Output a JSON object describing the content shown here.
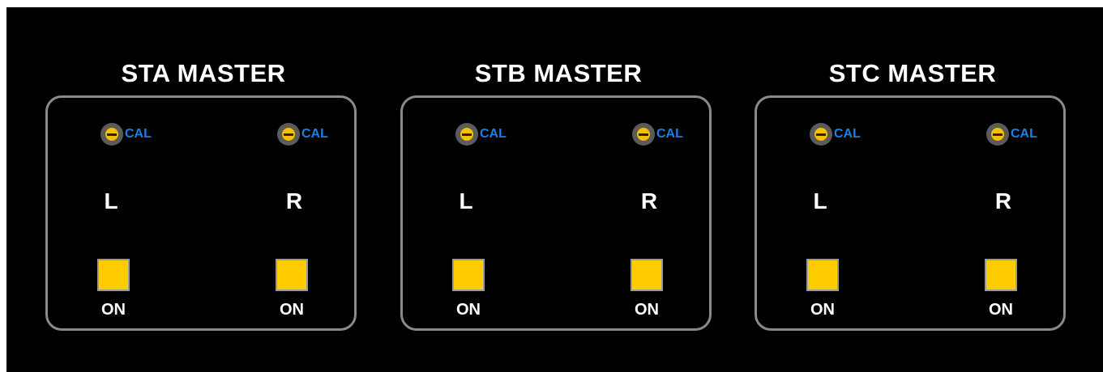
{
  "sections": [
    {
      "title": "STA MASTER",
      "channels": [
        {
          "cal_label": "CAL",
          "letter": "L",
          "on_label": "ON"
        },
        {
          "cal_label": "CAL",
          "letter": "R",
          "on_label": "ON"
        }
      ]
    },
    {
      "title": "STB MASTER",
      "channels": [
        {
          "cal_label": "CAL",
          "letter": "L",
          "on_label": "ON"
        },
        {
          "cal_label": "CAL",
          "letter": "R",
          "on_label": "ON"
        }
      ]
    },
    {
      "title": "STC MASTER",
      "channels": [
        {
          "cal_label": "CAL",
          "letter": "L",
          "on_label": "ON"
        },
        {
          "cal_label": "CAL",
          "letter": "R",
          "on_label": "ON"
        }
      ]
    }
  ],
  "colors": {
    "background": "#000000",
    "box_border": "#8a8a8a",
    "cal_text": "#1a7fe6",
    "knob_body": "#5b5b5b",
    "knob_center": "#f4c000",
    "on_button": "#ffcc00"
  },
  "icons": {
    "cal_knob": "trim-screw-icon"
  }
}
